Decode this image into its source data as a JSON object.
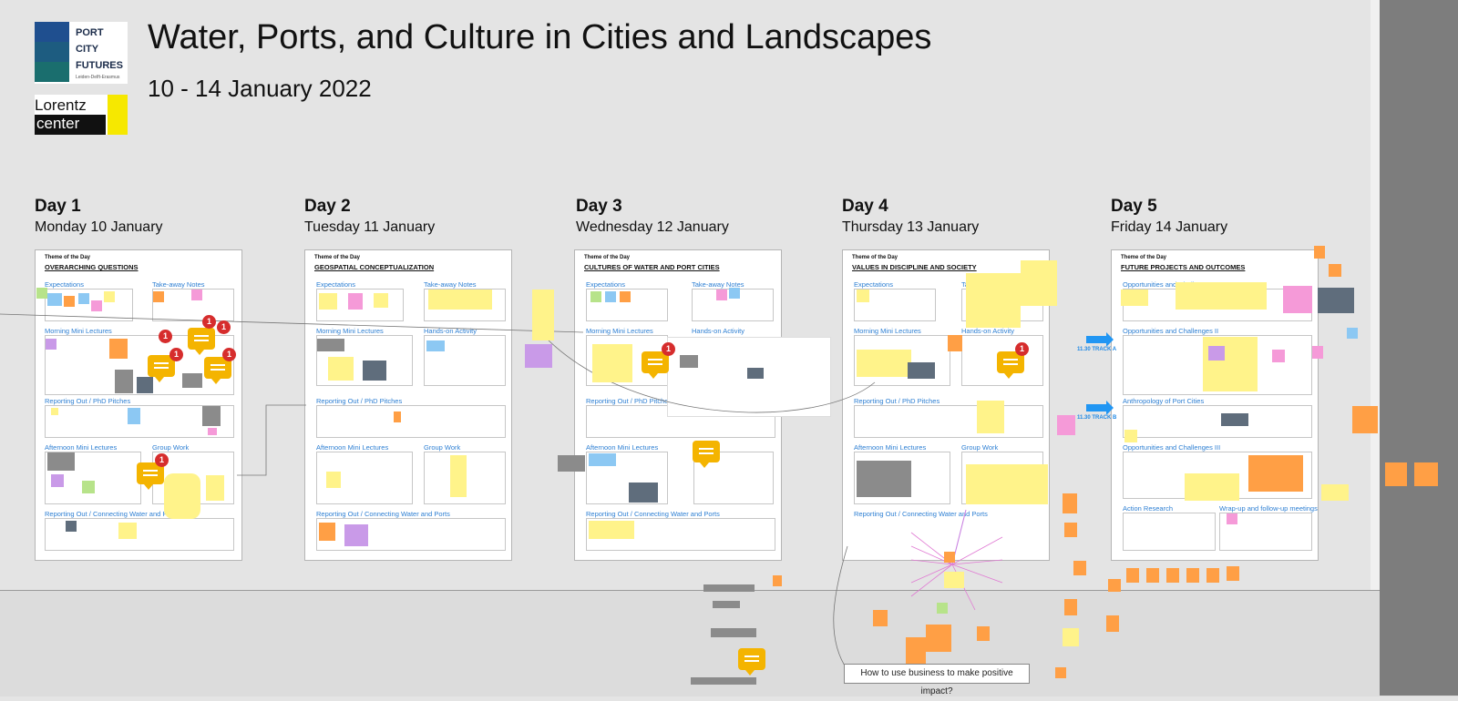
{
  "header": {
    "title": "Water, Ports, and Culture in Cities and Landscapes",
    "dates": "10 - 14 January 2022"
  },
  "logos": {
    "pcf_line1": "PORT",
    "pcf_line2": "CITY",
    "pcf_line3": "FUTURES",
    "pcf_sub": "Leiden-Delft-Erasmus",
    "lc_line1": "Lorentz",
    "lc_line2": "center",
    "brand_color": "#1f4f8f",
    "lc_color": "#f6e800"
  },
  "days": [
    {
      "day": "Day 1",
      "date": "Monday 10 January",
      "theme": "OVERARCHING QUESTIONS"
    },
    {
      "day": "Day 2",
      "date": "Tuesday 11 January",
      "theme": "GEOSPATIAL CONCEPTUALIZATION"
    },
    {
      "day": "Day 3",
      "date": "Wednesday 12 January",
      "theme": "CULTURES OF WATER AND PORT CITIES"
    },
    {
      "day": "Day 4",
      "date": "Thursday 13 January",
      "theme": "VALUES IN DISCIPLINE AND SOCIETY"
    },
    {
      "day": "Day 5",
      "date": "Friday 14 January",
      "theme": "FUTURE PROJECTS AND OUTCOMES"
    }
  ],
  "theme_label": "Theme of the Day",
  "sections": {
    "expectations": "Expectations",
    "takeaway": "Take-away Notes",
    "morning": "Morning Mini Lectures",
    "handson": "Hands-on Activity",
    "reporting": "Reporting Out / PhD Pitches",
    "afternoon": "Afternoon Mini Lectures",
    "groupwork": "Group Work",
    "connecting": "Reporting Out / Connecting Water and Ports"
  },
  "day5_sections": {
    "opp1": "Opportunities and Challenges I",
    "opp2": "Opportunities and Challenges II",
    "anthro": "Anthropology of Port Cities",
    "opp3": "Opportunities and Challenges III",
    "action": "Action Research",
    "wrapup": "Wrap-up and follow-up meetings"
  },
  "tracks": {
    "a": "11.30 TRACK A",
    "b": "11.30 TRACK B"
  },
  "badges": {
    "count": "1"
  },
  "question": "How to use business to make positive impact?",
  "colors": {
    "section_text": "#2d7fd3",
    "comment": "#f4b400",
    "badge": "#d62d2d",
    "track_arrow": "#2196f3"
  }
}
